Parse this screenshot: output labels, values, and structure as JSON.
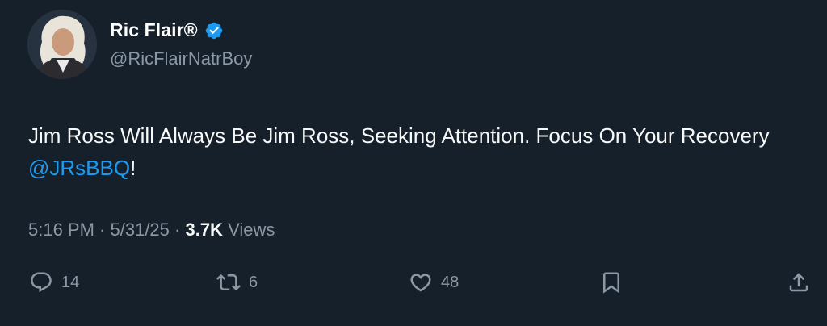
{
  "user": {
    "display_name": "Ric Flair®",
    "handle": "@RicFlairNatrBoy",
    "verified_icon": "verified-badge-icon",
    "avatar_icon": "avatar"
  },
  "tweet": {
    "text_before": "Jim Ross Will Always Be Jim Ross, Seeking Attention. Focus On Your Recovery ",
    "mention": "@JRsBBQ",
    "text_after": "!"
  },
  "meta": {
    "time": "5:16 PM",
    "separator": " · ",
    "date": "5/31/25",
    "views_count": "3.7K",
    "views_label": " Views"
  },
  "actions": {
    "reply_count": "14",
    "retweet_count": "6",
    "like_count": "48"
  },
  "colors": {
    "background": "#15202b",
    "accent": "#1d9bf0",
    "muted": "#8b98a5",
    "text": "#f7f9f9"
  }
}
